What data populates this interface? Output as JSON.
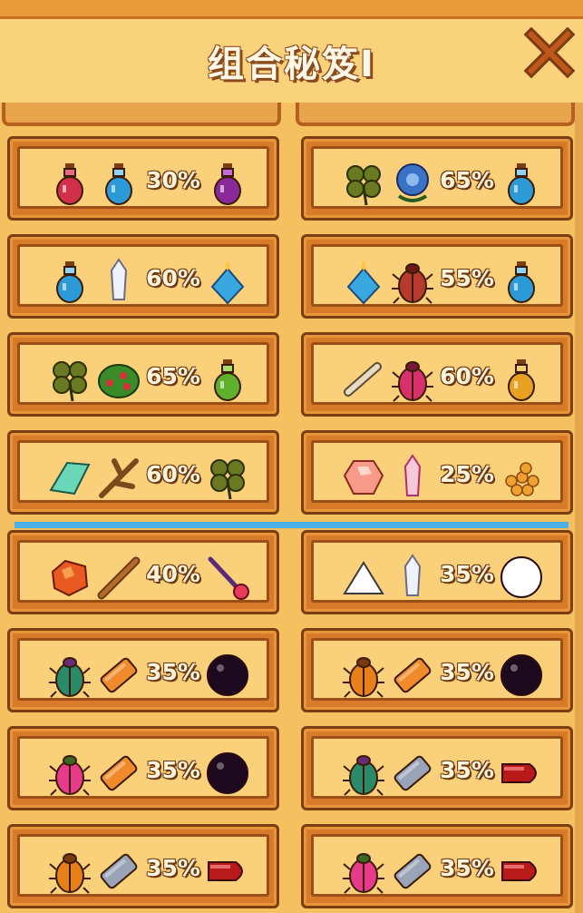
{
  "header": {
    "title": "组合秘笈I"
  },
  "recipes": [
    {
      "inputs": [
        "red-potion-icon",
        "blue-potion-icon"
      ],
      "chance": "30%",
      "output": "purple-potion-icon"
    },
    {
      "inputs": [
        "clover-icon",
        "blue-flower-icon"
      ],
      "chance": "65%",
      "output": "blue-potion-icon"
    },
    {
      "inputs": [
        "blue-potion-icon",
        "crystal-shard-icon"
      ],
      "chance": "60%",
      "output": "sparkle-potion-icon"
    },
    {
      "inputs": [
        "sparkle-potion-icon",
        "red-beetle-icon"
      ],
      "chance": "55%",
      "output": "blue-potion-icon"
    },
    {
      "inputs": [
        "clover-icon",
        "berry-bush-icon"
      ],
      "chance": "65%",
      "output": "green-potion-icon"
    },
    {
      "inputs": [
        "bone-icon",
        "magenta-beetle-icon"
      ],
      "chance": "60%",
      "output": "orange-potion-icon"
    },
    {
      "inputs": [
        "jade-shard-icon",
        "twig-icon"
      ],
      "chance": "60%",
      "output": "clover-icon"
    },
    {
      "inputs": [
        "pink-gem-icon",
        "pink-crystal-icon"
      ],
      "chance": "25%",
      "output": "orange-eggs-icon"
    },
    {
      "inputs": [
        "ore-chunk-icon",
        "stick-icon"
      ],
      "chance": "40%",
      "output": "magic-wand-icon"
    },
    {
      "inputs": [
        "salt-pile-icon",
        "crystal-shard-icon"
      ],
      "chance": "35%",
      "output": "white-orb-icon"
    },
    {
      "inputs": [
        "green-beetle-icon",
        "orange-bar-icon"
      ],
      "chance": "35%",
      "output": "dark-orb-icon"
    },
    {
      "inputs": [
        "orange-beetle-icon",
        "orange-bar-icon"
      ],
      "chance": "35%",
      "output": "dark-orb-icon"
    },
    {
      "inputs": [
        "pink-beetle-icon",
        "orange-bar-icon"
      ],
      "chance": "35%",
      "output": "dark-orb-icon"
    },
    {
      "inputs": [
        "green-beetle-icon",
        "gray-bar-icon"
      ],
      "chance": "35%",
      "output": "red-bullet-icon"
    },
    {
      "inputs": [
        "orange-beetle-icon",
        "gray-bar-icon"
      ],
      "chance": "35%",
      "output": "red-bullet-icon"
    },
    {
      "inputs": [
        "pink-beetle-icon",
        "gray-bar-icon"
      ],
      "chance": "35%",
      "output": "red-bullet-icon"
    }
  ],
  "colors": {
    "accent": "#4ab0e6",
    "card_border": "#7a3e12",
    "panel": "#f5c160"
  }
}
